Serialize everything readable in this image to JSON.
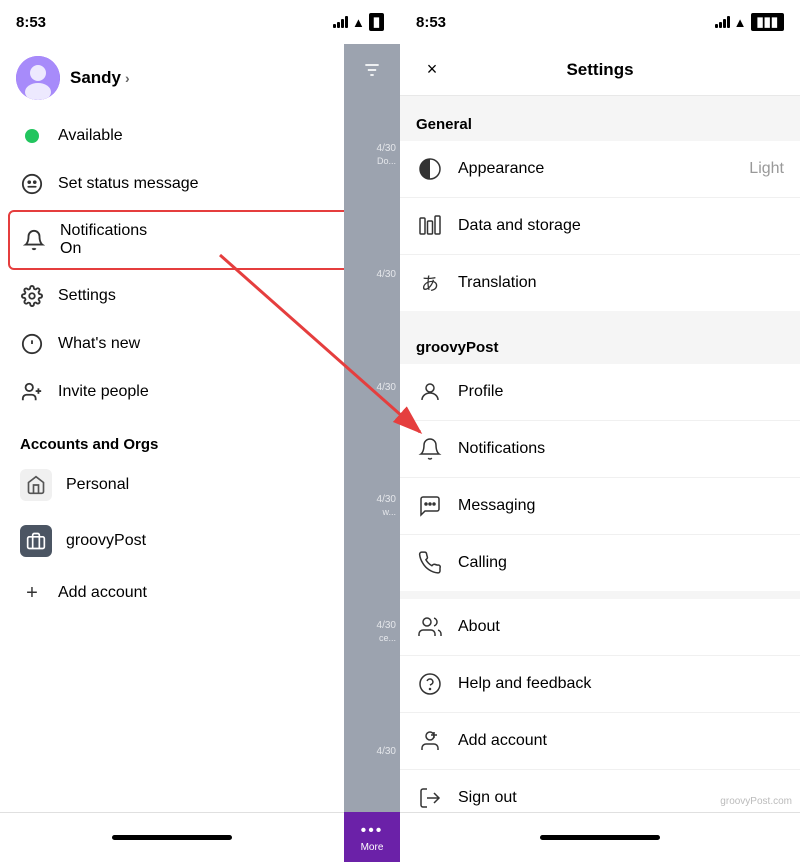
{
  "left": {
    "status_bar": {
      "time": "8:53"
    },
    "user": {
      "name": "Sandy",
      "chevron": "›"
    },
    "menu_items": [
      {
        "icon": "🟢",
        "label": "Available",
        "sub_label": ""
      },
      {
        "icon": "⊘",
        "label": "Set status message",
        "sub_label": ""
      },
      {
        "icon": "🔔",
        "label": "Notifications",
        "sub_label": "On",
        "highlighted": true
      },
      {
        "icon": "⚙️",
        "label": "Settings",
        "sub_label": ""
      },
      {
        "icon": "💡",
        "label": "What's new",
        "sub_label": ""
      },
      {
        "icon": "👤+",
        "label": "Invite people",
        "sub_label": ""
      }
    ],
    "accounts_section": "Accounts and Orgs",
    "accounts": [
      {
        "icon": "🏠",
        "label": "Personal",
        "check": false
      },
      {
        "icon": "💼",
        "label": "groovyPost",
        "check": true
      }
    ],
    "add_account": "Add account",
    "more_label": "More"
  },
  "right": {
    "status_bar": {
      "time": "8:53"
    },
    "header": {
      "close": "×",
      "title": "Settings"
    },
    "sections": [
      {
        "label": "General",
        "items": [
          {
            "icon": "◑",
            "label": "Appearance",
            "value": "Light"
          },
          {
            "icon": "📊",
            "label": "Data and storage",
            "value": ""
          },
          {
            "icon": "あ",
            "label": "Translation",
            "value": ""
          }
        ]
      },
      {
        "label": "groovyPost",
        "items": [
          {
            "icon": "👤",
            "label": "Profile",
            "value": ""
          },
          {
            "icon": "🔔",
            "label": "Notifications",
            "value": ""
          },
          {
            "icon": "💬",
            "label": "Messaging",
            "value": ""
          },
          {
            "icon": "📞",
            "label": "Calling",
            "value": ""
          }
        ]
      },
      {
        "label": "",
        "items": [
          {
            "icon": "👥",
            "label": "About",
            "value": ""
          },
          {
            "icon": "❓",
            "label": "Help and feedback",
            "value": ""
          },
          {
            "icon": "👤+",
            "label": "Add account",
            "value": ""
          },
          {
            "icon": "↩️",
            "label": "Sign out",
            "value": ""
          }
        ]
      }
    ],
    "watermark": "groovyPost.com"
  }
}
